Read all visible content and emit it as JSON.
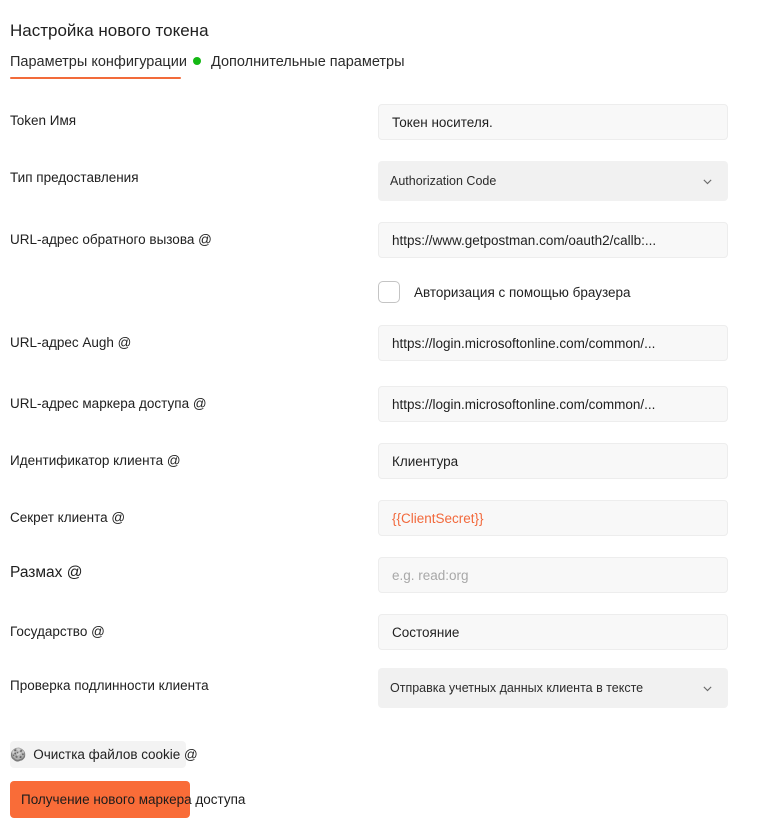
{
  "panel": {
    "title": "Настройка нового токена"
  },
  "tabs": {
    "config": {
      "label": "Параметры конфигурации",
      "has_dot": true,
      "dot_color": "#14b814",
      "active": true
    },
    "advanced": {
      "label": "Дополнительные параметры",
      "active": false
    },
    "underline_color": "#f26b3a"
  },
  "form": {
    "token_name": {
      "label": "Token   Имя",
      "value": "Токен носителя.",
      "type": "text"
    },
    "grant_type": {
      "label": "Тип предоставления",
      "value": "Authorization Code",
      "type": "select"
    },
    "callback_url": {
      "label": "URL-адрес обратного вызова @",
      "value": "https://www.getpostman.com/oauth2/callb:...",
      "type": "text"
    },
    "authorize_browser": {
      "label": "Авторизация с помощью браузера",
      "checked": false,
      "type": "checkbox"
    },
    "auth_url": {
      "label": "URL-адрес Augh @",
      "value": "https://login.microsoftonline.com/common/...",
      "type": "text"
    },
    "access_token_url": {
      "label": "URL-адрес маркера доступа @",
      "value": "https://login.microsoftonline.com/common/...",
      "type": "text"
    },
    "client_id": {
      "label": "Идентификатор клиента @",
      "value": "Клиентура",
      "type": "text"
    },
    "client_secret": {
      "label": "Секрет клиента @",
      "value": "{{ClientSecret}}",
      "value_color": "#f2693c",
      "type": "text"
    },
    "scope": {
      "label": "Размах @",
      "value": "",
      "placeholder": "e.g. read:org",
      "type": "text"
    },
    "state": {
      "label": "Государство @",
      "value": "Состояние",
      "type": "text"
    },
    "client_authentication": {
      "label": "Проверка подлинности клиента",
      "value": "Отправка учетных данных клиента в тексте",
      "type": "select"
    }
  },
  "actions": {
    "clear_cookies": {
      "label": "Очистка файлов cookie @",
      "icon": "cookie-icon",
      "glyph": "🍪"
    },
    "get_new_token": {
      "label": "Получение нового маркера доступа",
      "color": "#f96c38"
    }
  }
}
